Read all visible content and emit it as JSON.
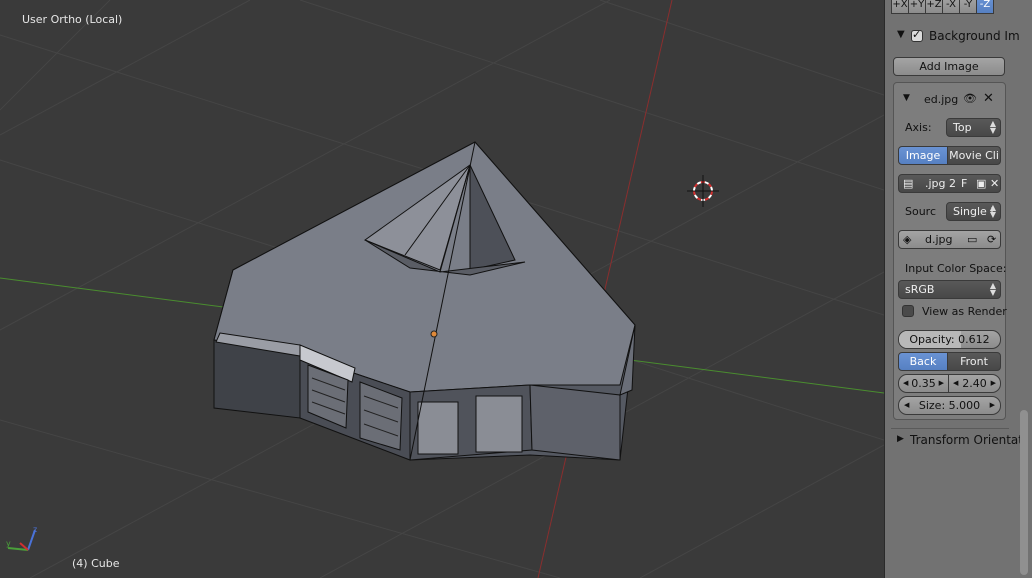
{
  "viewport": {
    "view_label": "User Ortho (Local)",
    "object_label": "(4) Cube"
  },
  "panel": {
    "axis_buttons": [
      "+X",
      "+Y",
      "+Z",
      "-X",
      "-Y",
      "-Z"
    ],
    "background_images": {
      "header": "Background Im",
      "enabled": true,
      "add_image": "Add Image",
      "image_name": "ed.jpg",
      "axis_label": "Axis:",
      "axis_value": "Top",
      "source_tabs": [
        "Image",
        "Movie Cli"
      ],
      "file_fields": [
        ".jpg",
        "2",
        "F"
      ],
      "source_label": "Sourc",
      "source_value": "Single I",
      "filepath": "d.jpg",
      "input_color_space_label": "Input Color Space:",
      "color_space_value": "sRGB",
      "view_as_render_label": "View as Render",
      "opacity_label": "Opacity: 0.612",
      "opacity": 0.612,
      "depth_tabs": [
        "Back",
        "Front"
      ],
      "offset_x": "0.35",
      "offset_y": "2.40",
      "size_label": "Size: 5.000"
    },
    "transform_orientation": "Transform Orientat"
  }
}
